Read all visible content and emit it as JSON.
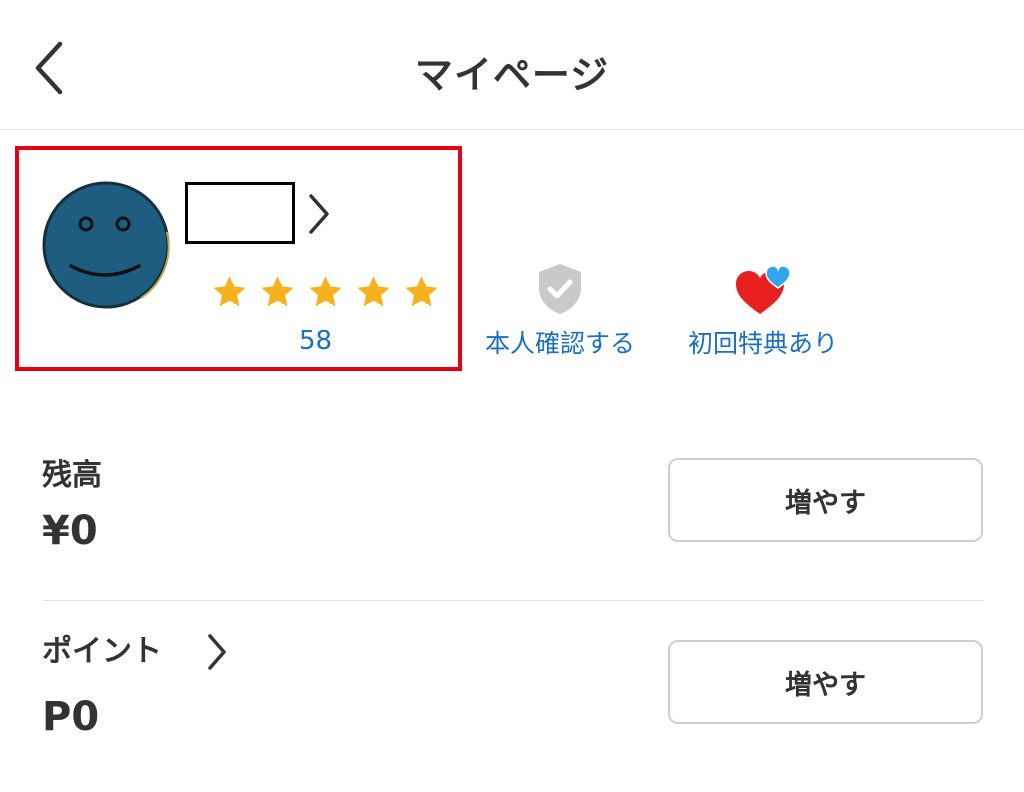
{
  "header": {
    "title": "マイページ",
    "back_icon": "chevron-left-icon"
  },
  "profile": {
    "name": "",
    "rating": 5,
    "rating_max": 5,
    "rating_count": "58",
    "highlight_color": "#e60012",
    "star_color": "#f6b21b",
    "avatar_color": "#1e5d80"
  },
  "badges": {
    "verify": {
      "label": "本人確認する",
      "icon": "shield-check-icon"
    },
    "first_time": {
      "label": "初回特典あり",
      "icon": "hearts-icon"
    }
  },
  "balance": {
    "label": "残高",
    "value": "¥0",
    "button_label": "増やす"
  },
  "points": {
    "label": "ポイント",
    "value": "P0",
    "button_label": "増やす"
  },
  "colors": {
    "link_blue": "#1a6fc4",
    "text": "#333333",
    "divider": "#e3e3e3"
  }
}
